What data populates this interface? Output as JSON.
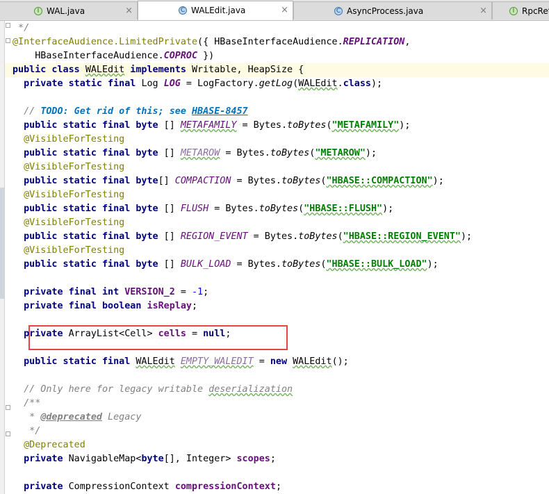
{
  "tabs": [
    {
      "label": "WAL.java",
      "icon": "interface-file-icon",
      "icon_glyph": "I",
      "close": "×",
      "active": false
    },
    {
      "label": "WALEdit.java",
      "icon": "class-file-icon",
      "icon_glyph": "C",
      "close": "×",
      "active": true
    },
    {
      "label": "AsyncProcess.java",
      "icon": "class-file-icon",
      "icon_glyph": "C",
      "close": "×",
      "active": false
    },
    {
      "label": "RpcRet",
      "icon": "interface-file-icon",
      "icon_glyph": "I",
      "close": "",
      "active": false
    }
  ],
  "code": {
    "l1": {
      "t1": " */"
    },
    "l2": {
      "t1": "@InterfaceAudience.LimitedPrivate",
      "t2": "({ HBaseInterfaceAudience.",
      "t3": "REPLICATION",
      "t4": ","
    },
    "l3": {
      "t1": "    HBaseInterfaceAudience.",
      "t2": "COPROC",
      "t3": " })"
    },
    "l4": {
      "t1": "public class ",
      "t2": "WALEdit",
      "t3": " implements ",
      "t4": "Writable, HeapSize {"
    },
    "l5": {
      "t1": "  private static final ",
      "t2": "Log ",
      "t3": "LOG",
      "t4": " = LogFactory.",
      "t5": "getLog",
      "t6": "(",
      "t7": "WALEdit",
      "t8": ".",
      "t9": "class",
      "t10": ");"
    },
    "l6": {
      "t1": "  // ",
      "t2": "TODO: Get rid of this; see ",
      "t3": "HBASE-8457"
    },
    "l7": {
      "t1": "  public static final byte ",
      "t2": "[] ",
      "t3": "METAFAMILY",
      "t4": " = Bytes.",
      "t5": "toBytes",
      "t6": "(",
      "t7": "\"METAFAMILY\"",
      "t8": ");"
    },
    "l8": {
      "t1": "  @VisibleForTesting"
    },
    "l9": {
      "t1": "  public static final byte ",
      "t2": "[] ",
      "t3": "METAROW",
      "t4": " = Bytes.",
      "t5": "toBytes",
      "t6": "(",
      "t7": "\"METAROW\"",
      "t8": ");"
    },
    "l10": {
      "t1": "  @VisibleForTesting"
    },
    "l11": {
      "t1": "  public static final byte",
      "t2": "[] ",
      "t3": "COMPACTION",
      "t4": " = Bytes.",
      "t5": "toBytes",
      "t6": "(",
      "t7": "\"HBASE::COMPACTION\"",
      "t8": ");"
    },
    "l12": {
      "t1": "  @VisibleForTesting"
    },
    "l13": {
      "t1": "  public static final byte ",
      "t2": "[] ",
      "t3": "FLUSH",
      "t4": " = Bytes.",
      "t5": "toBytes",
      "t6": "(",
      "t7": "\"HBASE::FLUSH\"",
      "t8": ");"
    },
    "l14": {
      "t1": "  @VisibleForTesting"
    },
    "l15": {
      "t1": "  public static final byte ",
      "t2": "[] ",
      "t3": "REGION_EVENT",
      "t4": " = Bytes.",
      "t5": "toBytes",
      "t6": "(",
      "t7": "\"HBASE::REGION_EVENT\"",
      "t8": ");"
    },
    "l16": {
      "t1": "  @VisibleForTesting"
    },
    "l17": {
      "t1": "  public static final byte ",
      "t2": "[] ",
      "t3": "BULK_LOAD",
      "t4": " = Bytes.",
      "t5": "toBytes",
      "t6": "(",
      "t7": "\"HBASE::BULK_LOAD\"",
      "t8": ");"
    },
    "l18": {
      "t1": "  private final int ",
      "t2": "VERSION_2",
      "t3": " = ",
      "t4": "-1",
      "t5": ";"
    },
    "l19": {
      "t1": "  private final boolean ",
      "t2": "isReplay",
      "t3": ";"
    },
    "l20": {
      "t1": "  private ",
      "t2": "ArrayList<Cell> ",
      "t3": "cells",
      "t4": " = ",
      "t5": "null",
      "t6": ";"
    },
    "l21": {
      "t1": "  public static final ",
      "t2": "WALEdit",
      "t3": " ",
      "t4": "EMPTY_WALEDIT",
      "t5": " = ",
      "t6": "new ",
      "t7": "WALEdit",
      "t8": "();"
    },
    "l22": {
      "t1": "  // Only here for legacy writable ",
      "t2": "deserialization"
    },
    "l23": {
      "t1": "  /**"
    },
    "l24": {
      "t1": "   * ",
      "t2": "@deprecated",
      "t3": " Legacy"
    },
    "l25": {
      "t1": "   */"
    },
    "l26": {
      "t1": "  @Deprecated"
    },
    "l27": {
      "t1": "  private ",
      "t2": "NavigableMap<",
      "t3": "byte",
      "t4": "[], Integer> ",
      "t5": "scopes",
      "t6": ";"
    },
    "l28": {
      "t1": "  private ",
      "t2": "CompressionContext ",
      "t3": "compressionContext",
      "t4": ";"
    }
  },
  "colors": {
    "keyword": "#000080",
    "annotation": "#808000",
    "static_field": "#660e7a",
    "string": "#008000",
    "number": "#0000ff",
    "comment": "#808080",
    "todo": "#0073bf",
    "highlight_box": "#e5463f",
    "current_line": "#fdfce3"
  }
}
